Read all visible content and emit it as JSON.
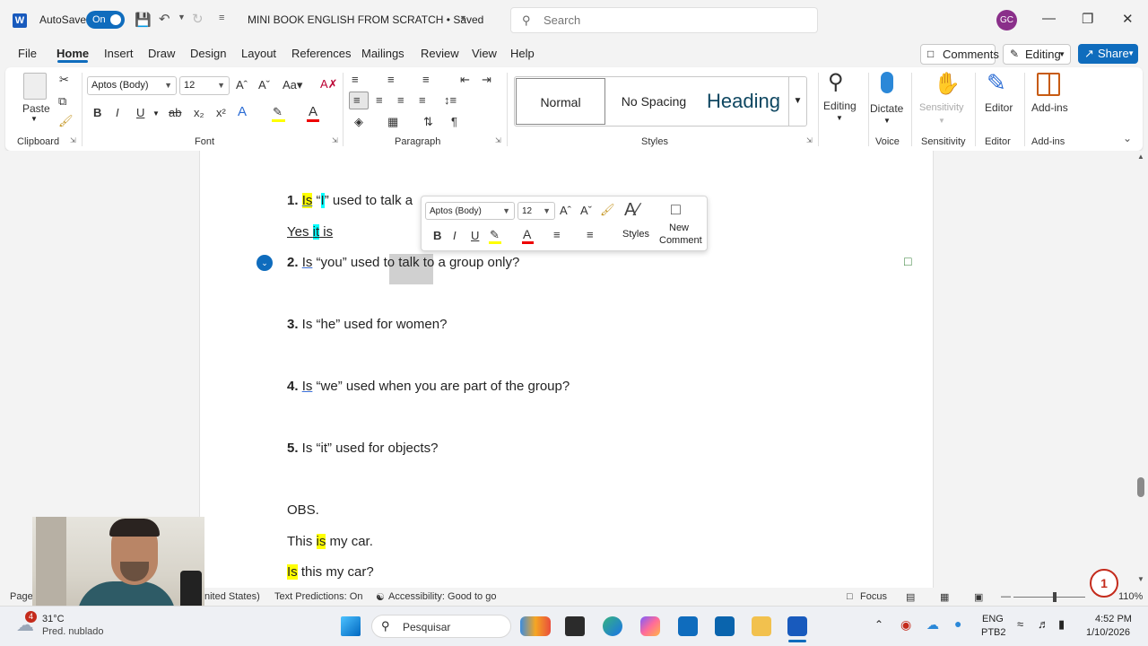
{
  "titlebar": {
    "autosave_label": "AutoSave",
    "autosave_state": "On",
    "document_title": "MINI BOOK ENGLISH FROM SCRATCH • Saved",
    "search_placeholder": "Search",
    "user_initials": "GC"
  },
  "menu": {
    "tabs": [
      "File",
      "Home",
      "Insert",
      "Draw",
      "Design",
      "Layout",
      "References",
      "Mailings",
      "Review",
      "View",
      "Help"
    ],
    "active": "Home",
    "comments_label": "Comments",
    "editing_label": "Editing",
    "share_label": "Share"
  },
  "ribbon": {
    "clipboard": {
      "paste": "Paste",
      "group": "Clipboard"
    },
    "font": {
      "family": "Aptos (Body)",
      "size": "12",
      "group": "Font"
    },
    "paragraph": {
      "group": "Paragraph"
    },
    "styles": {
      "normal": "Normal",
      "no_spacing": "No Spacing",
      "heading": "Heading",
      "group": "Styles"
    },
    "editing": {
      "label": "Editing"
    },
    "voice": {
      "dictate": "Dictate",
      "group": "Voice"
    },
    "sensitivity": {
      "label": "Sensitivity",
      "group": "Sensitivity"
    },
    "editor": {
      "label": "Editor",
      "group": "Editor"
    },
    "addins": {
      "label": "Add-ins",
      "group": "Add-ins"
    }
  },
  "mini_toolbar": {
    "font": "Aptos (Body)",
    "size": "12",
    "styles_label": "Styles",
    "new_comment_1": "New",
    "new_comment_2": "Comment"
  },
  "document": {
    "q1_num": "1.",
    "q1_is": "Is",
    "q1_open": " “",
    "q1_i": "I",
    "q1_rest": "” used to talk a",
    "a1_yes": "Yes ",
    "a1_it": "it",
    "a1_is": " is",
    "q2_num": "2.",
    "q2_is": "Is",
    "q2_a": " “you” used ",
    "q2_sel": "to talk",
    "q2_b": " to a group only?",
    "q3_num": "3.",
    "q3_text": " Is “he” used for women?",
    "q4_num": "4.",
    "q4_is": "Is",
    "q4_text": " “we” used when you are part of the group?",
    "q5_num": "5.",
    "q5_text": " Is “it” used for objects?",
    "obs": "OBS.",
    "ex1_a": "This ",
    "ex1_is": "is",
    "ex1_b": " my car.",
    "ex2_is": "Is",
    "ex2_b": " this my car?"
  },
  "statusbar": {
    "page": "Page",
    "language": "nited States)",
    "text_predictions": "Text Predictions: On",
    "accessibility": "Accessibility: Good to go",
    "focus": "Focus",
    "zoom": "110%"
  },
  "notification_count": "1",
  "taskbar": {
    "weather_temp": "31°C",
    "weather_desc": "Pred. nublado",
    "weather_badge": "4",
    "search_label": "Pesquisar",
    "lang_1": "ENG",
    "lang_2": "PTB2",
    "time": "4:52 PM",
    "date": "1/10/2026"
  }
}
